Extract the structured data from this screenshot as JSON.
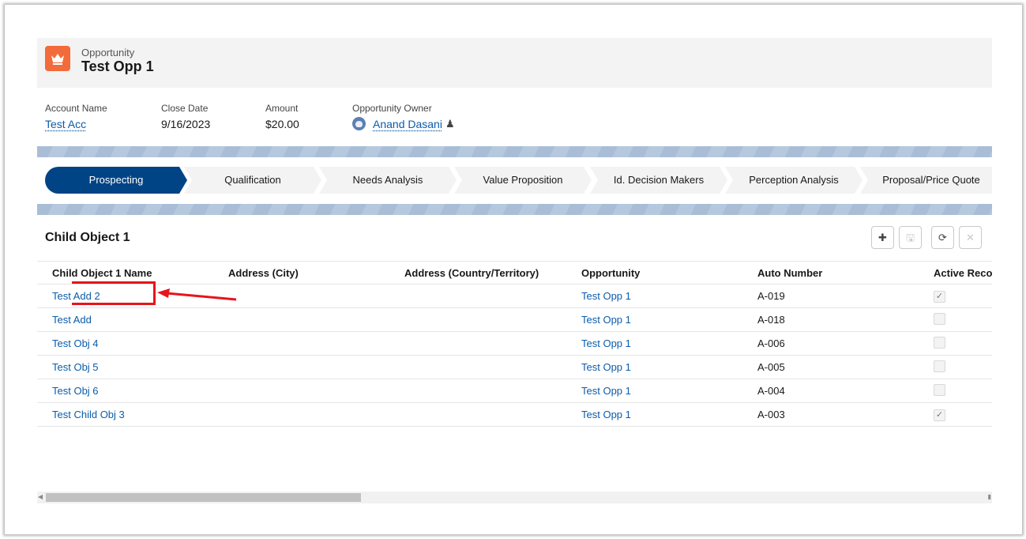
{
  "header": {
    "object_type": "Opportunity",
    "title": "Test Opp 1",
    "icon": "crown-icon"
  },
  "fields": [
    {
      "label": "Account Name",
      "value": "Test Acc",
      "link": true
    },
    {
      "label": "Close Date",
      "value": "9/16/2023",
      "link": false
    },
    {
      "label": "Amount",
      "value": "$20.00",
      "link": false
    }
  ],
  "owner": {
    "label": "Opportunity Owner",
    "name": "Anand Dasani"
  },
  "path": {
    "active": "Prospecting",
    "stages": [
      "Prospecting",
      "Qualification",
      "Needs Analysis",
      "Value Proposition",
      "Id. Decision Makers",
      "Perception Analysis",
      "Proposal/Price Quote"
    ]
  },
  "related_list": {
    "title": "Child Object 1",
    "buttons": [
      "add-icon",
      "save-icon",
      "refresh-icon",
      "close-icon"
    ],
    "columns": [
      "Child Object 1 Name",
      "Address (City)",
      "Address (Country/Territory)",
      "Opportunity",
      "Auto Number",
      "Active Reco"
    ],
    "rows": [
      {
        "name": "Test Add 2",
        "city": "",
        "country": "",
        "opportunity": "Test Opp 1",
        "auto_number": "A-019",
        "active": true
      },
      {
        "name": "Test Add",
        "city": "",
        "country": "",
        "opportunity": "Test Opp 1",
        "auto_number": "A-018",
        "active": false
      },
      {
        "name": "Test Obj 4",
        "city": "",
        "country": "",
        "opportunity": "Test Opp 1",
        "auto_number": "A-006",
        "active": false
      },
      {
        "name": "Test Obj 5",
        "city": "",
        "country": "",
        "opportunity": "Test Opp 1",
        "auto_number": "A-005",
        "active": false
      },
      {
        "name": "Test Obj 6",
        "city": "",
        "country": "",
        "opportunity": "Test Opp 1",
        "auto_number": "A-004",
        "active": false
      },
      {
        "name": "Test Child Obj 3",
        "city": "",
        "country": "",
        "opportunity": "Test Opp 1",
        "auto_number": "A-003",
        "active": true
      }
    ]
  },
  "scrollbar": {
    "position_fraction": 0.0
  },
  "annotation": {
    "highlighted_row": "Test Add 2",
    "color": "#e8141b"
  },
  "colors": {
    "active_stage": "#014486",
    "link": "#0b5cab",
    "icon_bg": "#f26b3a"
  }
}
